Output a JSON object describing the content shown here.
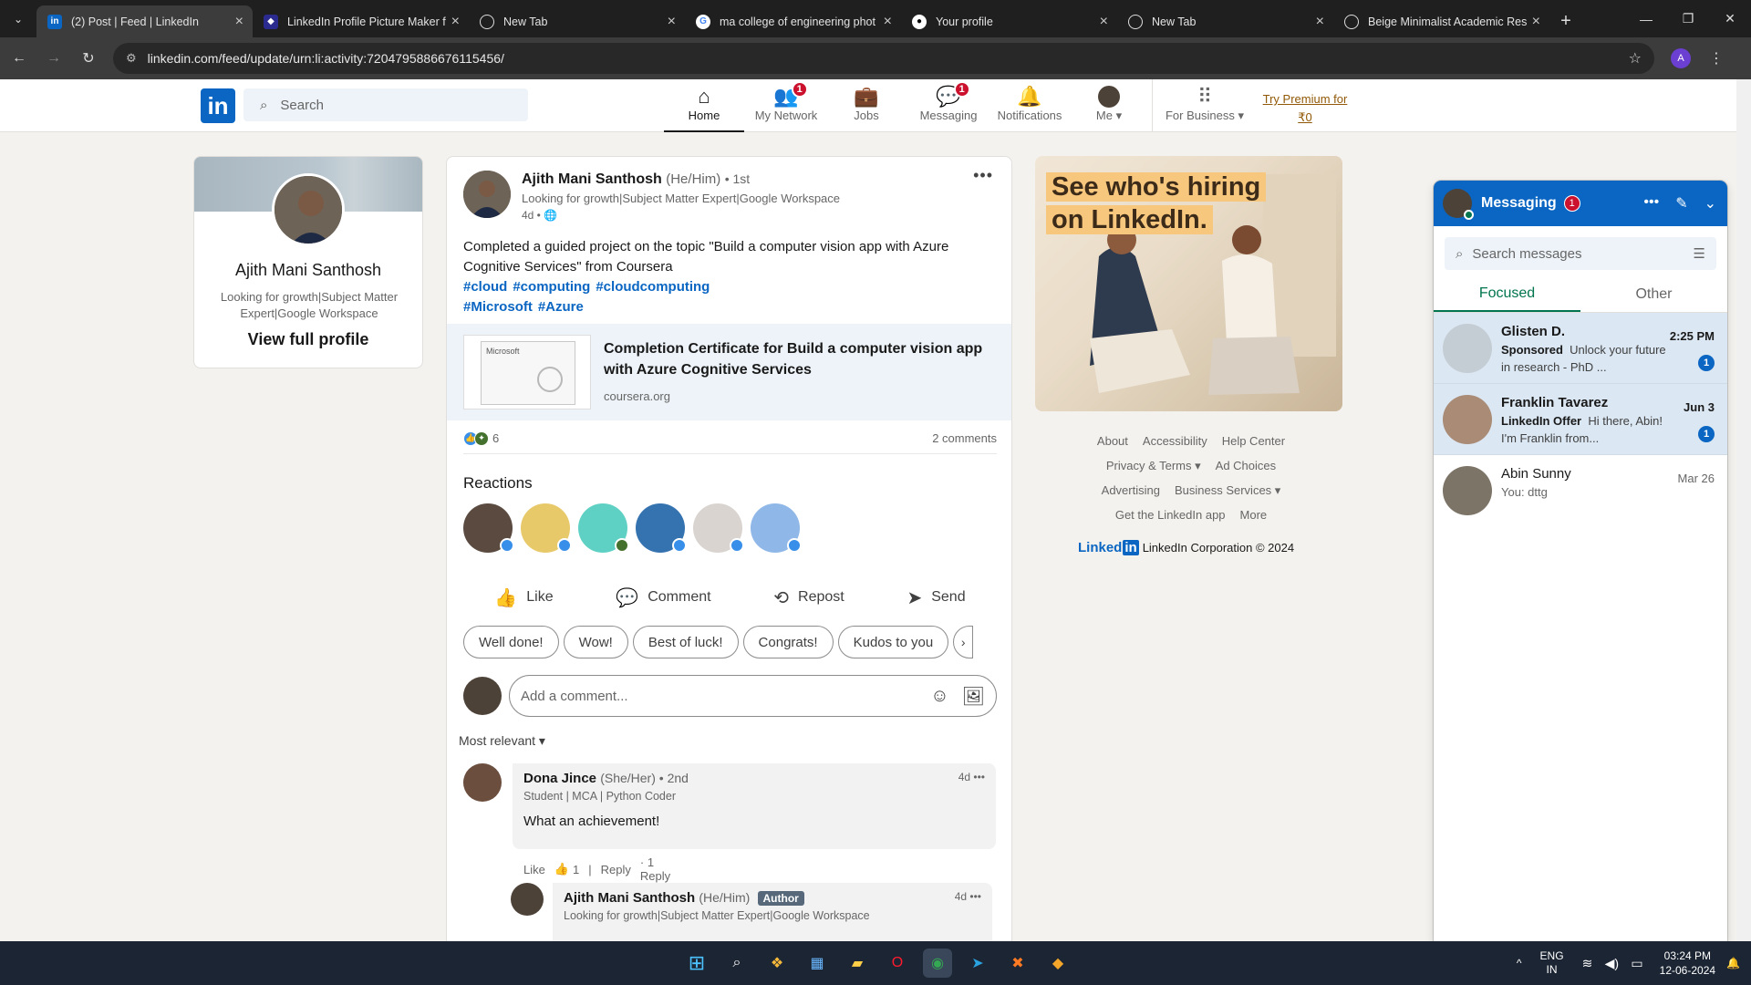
{
  "browser": {
    "tabs": [
      {
        "title": "(2) Post | Feed | LinkedIn",
        "favicon": "linkedin-icon",
        "active": true
      },
      {
        "title": "LinkedIn Profile Picture Maker f",
        "favicon": "pfp-maker-icon",
        "active": false
      },
      {
        "title": "New Tab",
        "favicon": "globe-icon",
        "active": false
      },
      {
        "title": "ma college of engineering phot",
        "favicon": "google-icon",
        "active": false
      },
      {
        "title": "Your profile",
        "favicon": "github-icon",
        "active": false
      },
      {
        "title": "New Tab",
        "favicon": "globe-icon",
        "active": false
      },
      {
        "title": "Beige Minimalist Academic Res",
        "favicon": "globe-icon",
        "active": false
      }
    ],
    "url": "linkedin.com/feed/update/urn:li:activity:7204795886676115456/",
    "profile_initial": "A"
  },
  "header": {
    "search_placeholder": "Search",
    "nav": [
      {
        "label": "Home",
        "icon": "home-icon",
        "badge": ""
      },
      {
        "label": "My Network",
        "icon": "network-icon",
        "badge": "1"
      },
      {
        "label": "Jobs",
        "icon": "briefcase-icon",
        "badge": ""
      },
      {
        "label": "Messaging",
        "icon": "message-icon",
        "badge": "1"
      },
      {
        "label": "Notifications",
        "icon": "bell-icon",
        "badge": ""
      },
      {
        "label": "Me",
        "icon": "avatar",
        "badge": ""
      },
      {
        "label": "For Business",
        "icon": "grid-icon",
        "badge": ""
      }
    ],
    "premium": "Try Premium for ₹0"
  },
  "profile": {
    "name": "Ajith Mani Santhosh",
    "headline": "Looking for growth|Subject Matter Expert|Google Workspace",
    "link": "View full profile"
  },
  "post": {
    "author": "Ajith Mani Santhosh",
    "pronouns": "(He/Him)",
    "degree": "• 1st",
    "headline": "Looking for growth|Subject Matter Expert|Google Workspace",
    "time": "4d •",
    "body": "Completed a guided project on the topic \"Build a computer vision app with Azure Cognitive Services\" from Coursera",
    "hashtags_line1": [
      "#cloud",
      "#computing",
      "#cloudcomputing"
    ],
    "hashtags_line2": [
      "#Microsoft",
      "#Azure"
    ],
    "preview": {
      "thumb_label": "Microsoft",
      "title": "Completion Certificate for Build a computer vision app with Azure Cognitive Services",
      "source": "coursera.org"
    },
    "reaction_count": "6",
    "comments_count": "2 comments",
    "reactions_title": "Reactions",
    "actions": [
      {
        "label": "Like",
        "icon": "thumbs-up-icon"
      },
      {
        "label": "Comment",
        "icon": "comment-icon"
      },
      {
        "label": "Repost",
        "icon": "repost-icon"
      },
      {
        "label": "Send",
        "icon": "send-icon"
      }
    ],
    "quick_replies": [
      "Well done!",
      "Wow!",
      "Best of luck!",
      "Congrats!",
      "Kudos to you"
    ],
    "comment_placeholder": "Add a comment...",
    "sort": "Most relevant ▾"
  },
  "comments": [
    {
      "name": "Dona Jince",
      "pronouns": "(She/Her) • 2nd",
      "headline": "Student | MCA | Python Coder",
      "text": "What an achievement!",
      "time": "4d",
      "like": "Like",
      "like_count": "1",
      "reply": "Reply",
      "replies": "· 1 Reply"
    },
    {
      "name": "Ajith Mani Santhosh",
      "pronouns": "(He/Him)",
      "badge": "Author",
      "headline": "Looking for growth|Subject Matter Expert|Google Workspace",
      "time": "4d"
    }
  ],
  "ad": {
    "line1": "See who's hiring",
    "line2": "on LinkedIn."
  },
  "footer": {
    "row1": [
      "About",
      "Accessibility",
      "Help Center"
    ],
    "row2": [
      "Privacy & Terms ▾",
      "Ad Choices"
    ],
    "row3": [
      "Advertising",
      "Business Services ▾"
    ],
    "row4": [
      "Get the LinkedIn app",
      "More"
    ],
    "brand": "Linked",
    "brand_in": "in",
    "corp": "LinkedIn Corporation © 2024"
  },
  "messaging": {
    "title": "Messaging",
    "badge": "1",
    "search_placeholder": "Search messages",
    "tabs": [
      "Focused",
      "Other"
    ],
    "conversations": [
      {
        "name": "Glisten D.",
        "date": "2:25 PM",
        "label": "Sponsored",
        "preview": "Unlock your future in research - PhD ...",
        "unread": "1"
      },
      {
        "name": "Franklin Tavarez",
        "date": "Jun 3",
        "label": "LinkedIn Offer",
        "preview": "Hi there, Abin! I'm Franklin from...",
        "unread": "1"
      },
      {
        "name": "Abin Sunny",
        "date": "Mar 26",
        "label": "",
        "preview": "You: dttg",
        "unread": ""
      }
    ]
  },
  "taskbar": {
    "lang1": "ENG",
    "lang2": "IN",
    "time": "03:24 PM",
    "date": "12-06-2024"
  }
}
